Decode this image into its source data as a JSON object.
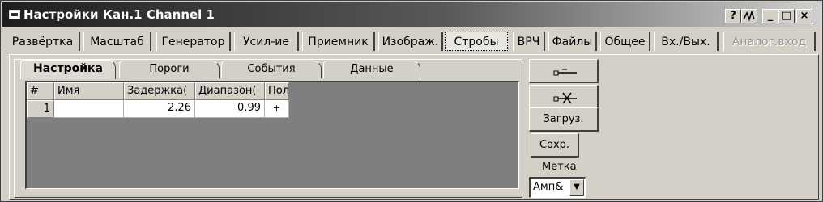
{
  "window": {
    "title": "Настройки Кан.1 Channel 1",
    "controls": {
      "help": "?",
      "wave": "⩘",
      "minimize": "_",
      "maximize": "□",
      "close": "×"
    }
  },
  "main_tabs": [
    {
      "label": "Развёртка"
    },
    {
      "label": "Масштаб"
    },
    {
      "label": "Генератор"
    },
    {
      "label": "Усил-ие"
    },
    {
      "label": "Приемник"
    },
    {
      "label": "Изображ."
    },
    {
      "label": "Стробы",
      "active": true
    },
    {
      "label": "ВРЧ"
    },
    {
      "label": "Файлы"
    },
    {
      "label": "Общее"
    },
    {
      "label": "Вх./Вых."
    },
    {
      "label": "Аналог.вход",
      "disabled": true
    }
  ],
  "sub_tabs": [
    {
      "label": "Настройка",
      "active": true
    },
    {
      "label": "Пороги"
    },
    {
      "label": "События"
    },
    {
      "label": "Данные"
    }
  ],
  "table": {
    "headers": [
      "#",
      "Имя",
      "Задержка(",
      "Диапазон(",
      "Пол"
    ],
    "rows": [
      {
        "num": "1",
        "name": "",
        "delay": "2.26",
        "range": "0.99",
        "polarity": "+"
      }
    ]
  },
  "right_panel": {
    "add_strobe_icon": "strobe-add-icon",
    "remove_strobe_icon": "strobe-remove-icon",
    "load_label": "Загруз.",
    "save_label": "Сохр.",
    "mark_label": "Метка",
    "mark_value": "Амп&"
  }
}
